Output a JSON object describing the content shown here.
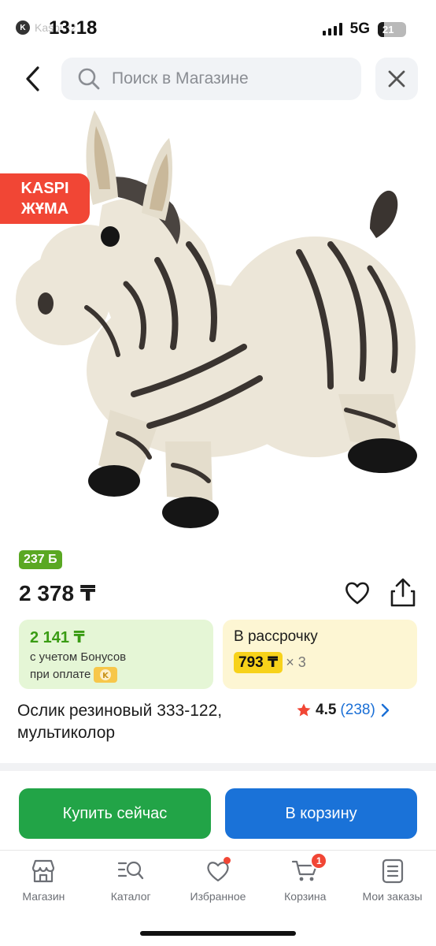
{
  "status_bar": {
    "time": "13:18",
    "app_back_label": "Kaspi.kz",
    "network": "5G",
    "battery_percent": "21"
  },
  "search": {
    "placeholder": "Поиск в Магазине"
  },
  "product": {
    "promo_badge_line1": "KASPI",
    "promo_badge_line2": "ЖҰМА",
    "image_icon": "zebra-toy-image",
    "bonus_badge": "237 Б",
    "price": "2 378 ₸",
    "bonus_card": {
      "price": "2 141 ₸",
      "note_line1": "с учетом Бонусов",
      "note_line2": "при оплате"
    },
    "installment_card": {
      "title": "В рассрочку",
      "monthly": "793 ₸",
      "multiplier": "× 3"
    },
    "title": "Ослик резиновый 333-122, мультиколор",
    "rating": "4.5",
    "reviews": "(238)"
  },
  "actions": {
    "buy_now": "Купить сейчас",
    "add_to_cart": "В корзину"
  },
  "bottom_nav": {
    "items": [
      {
        "label": "Магазин",
        "icon": "store-icon"
      },
      {
        "label": "Каталог",
        "icon": "catalog-search-icon"
      },
      {
        "label": "Избранное",
        "icon": "heart-icon"
      },
      {
        "label": "Корзина",
        "icon": "cart-icon",
        "badge": "1"
      },
      {
        "label": "Мои заказы",
        "icon": "orders-icon"
      }
    ]
  },
  "colors": {
    "promo": "#f14635",
    "bonus_green": "#5aa823",
    "buy_green": "#22a447",
    "cart_blue": "#1a72d8",
    "installment_yellow": "#f7d21a"
  }
}
